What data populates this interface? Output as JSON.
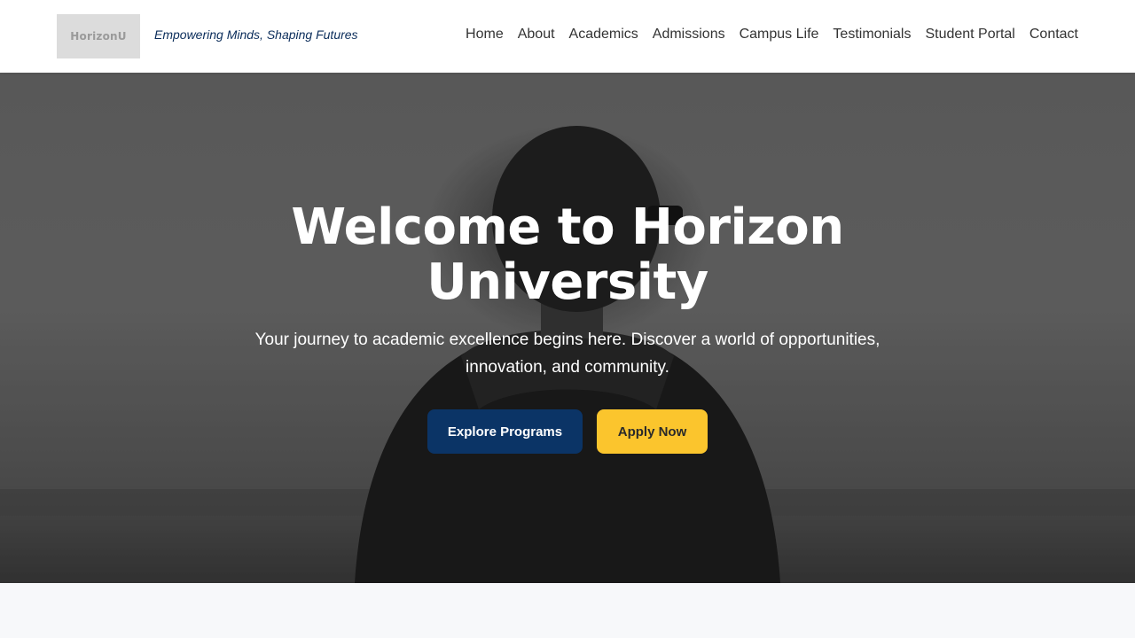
{
  "header": {
    "logo_text": "HorizonU",
    "tagline": "Empowering Minds, Shaping Futures",
    "nav": [
      "Home",
      "About",
      "Academics",
      "Admissions",
      "Campus Life",
      "Testimonials",
      "Student Portal",
      "Contact"
    ]
  },
  "hero": {
    "title": "Welcome to Horizon University",
    "subtitle": "Your journey to academic excellence begins here. Discover a world of opportunities, innovation, and community.",
    "primary_button": "Explore Programs",
    "secondary_button": "Apply Now"
  },
  "colors": {
    "brand_navy": "#0b3466",
    "accent_yellow": "#fbc52d",
    "header_bg": "#ffffff",
    "page_bg": "#f7f8fa"
  }
}
